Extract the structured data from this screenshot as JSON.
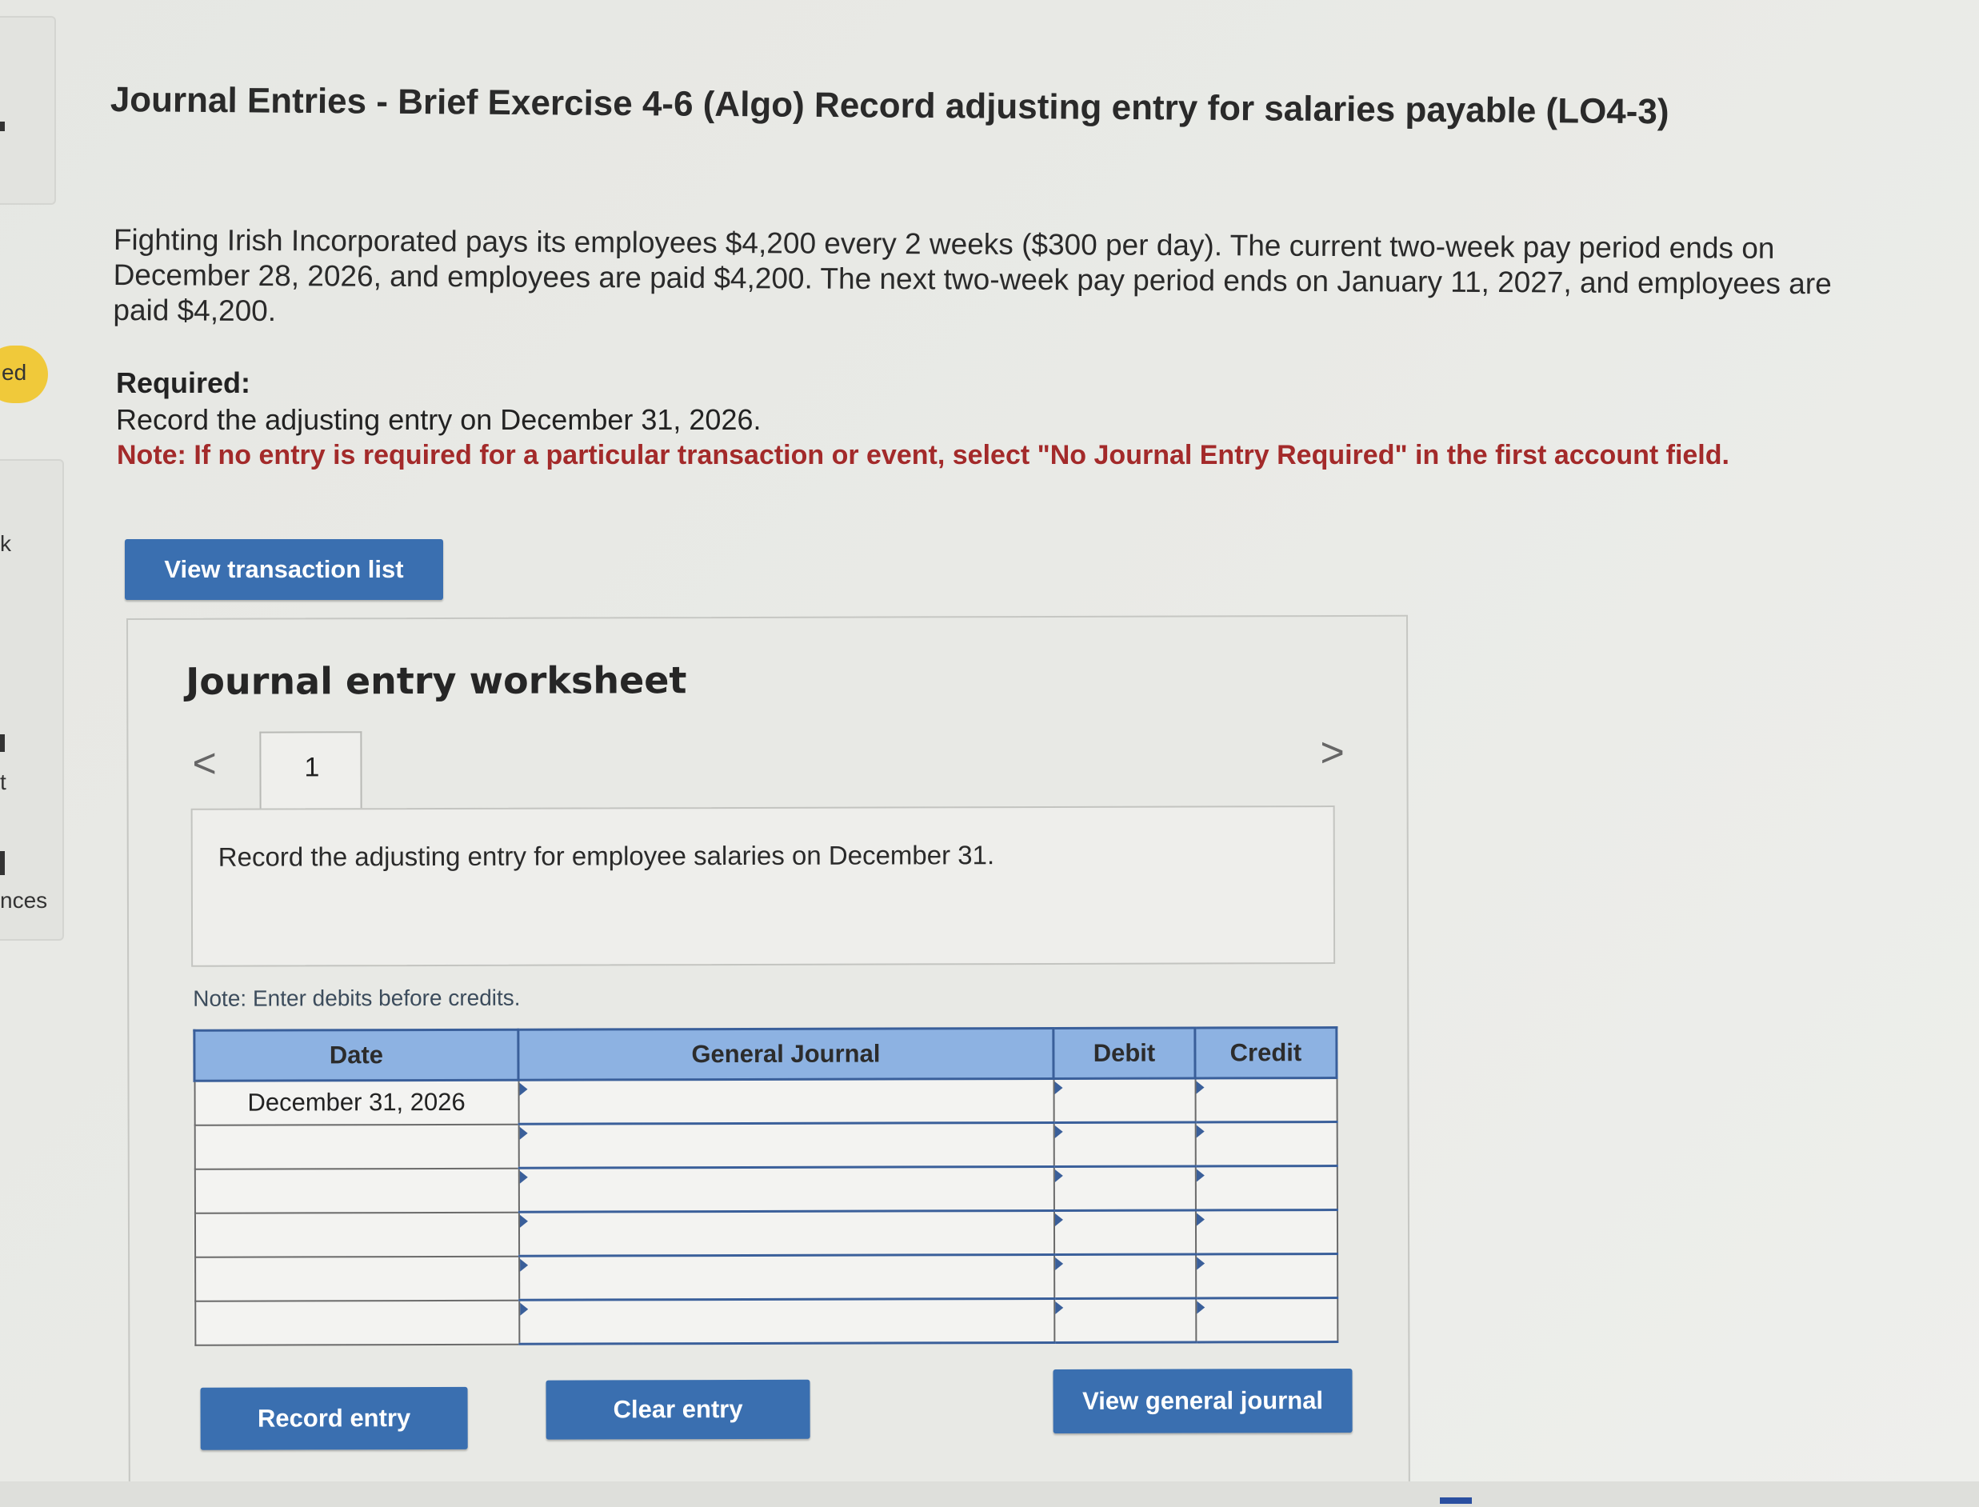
{
  "sidebar": {
    "fragments": [
      "ed",
      "k",
      "t",
      "nces"
    ]
  },
  "header": {
    "title": "Journal Entries - Brief Exercise 4-6 (Algo) Record adjusting entry for salaries payable (LO4-3)"
  },
  "problem": {
    "text": "Fighting Irish Incorporated pays its employees $4,200 every 2 weeks ($300 per day). The current two-week pay period ends on December 28, 2026, and employees are paid $4,200. The next two-week pay period ends on January 11, 2027, and employees are paid $4,200.",
    "required_label": "Required:",
    "required_text": "Record the adjusting entry on December 31, 2026.",
    "note": "Note: If no entry is required for a particular transaction or event, select \"No Journal Entry Required\" in the first account field."
  },
  "buttons": {
    "view_transaction_list": "View transaction list",
    "record_entry": "Record entry",
    "clear_entry": "Clear entry",
    "view_general_journal": "View general journal"
  },
  "worksheet": {
    "title": "Journal entry worksheet",
    "prev_glyph": "<",
    "next_glyph": ">",
    "tab_label": "1",
    "instruction": "Record the adjusting entry for employee salaries on December 31.",
    "note": "Note: Enter debits before credits.",
    "columns": [
      "Date",
      "General Journal",
      "Debit",
      "Credit"
    ],
    "rows": [
      {
        "date": "December 31, 2026",
        "account": "",
        "debit": "",
        "credit": ""
      },
      {
        "date": "",
        "account": "",
        "debit": "",
        "credit": ""
      },
      {
        "date": "",
        "account": "",
        "debit": "",
        "credit": ""
      },
      {
        "date": "",
        "account": "",
        "debit": "",
        "credit": ""
      },
      {
        "date": "",
        "account": "",
        "debit": "",
        "credit": ""
      },
      {
        "date": "",
        "account": "",
        "debit": "",
        "credit": ""
      }
    ]
  },
  "colors": {
    "button_blue": "#3a6fb0",
    "header_blue": "#8db2e2",
    "note_red": "#a32a2a",
    "badge_yellow": "#f0c93a"
  }
}
